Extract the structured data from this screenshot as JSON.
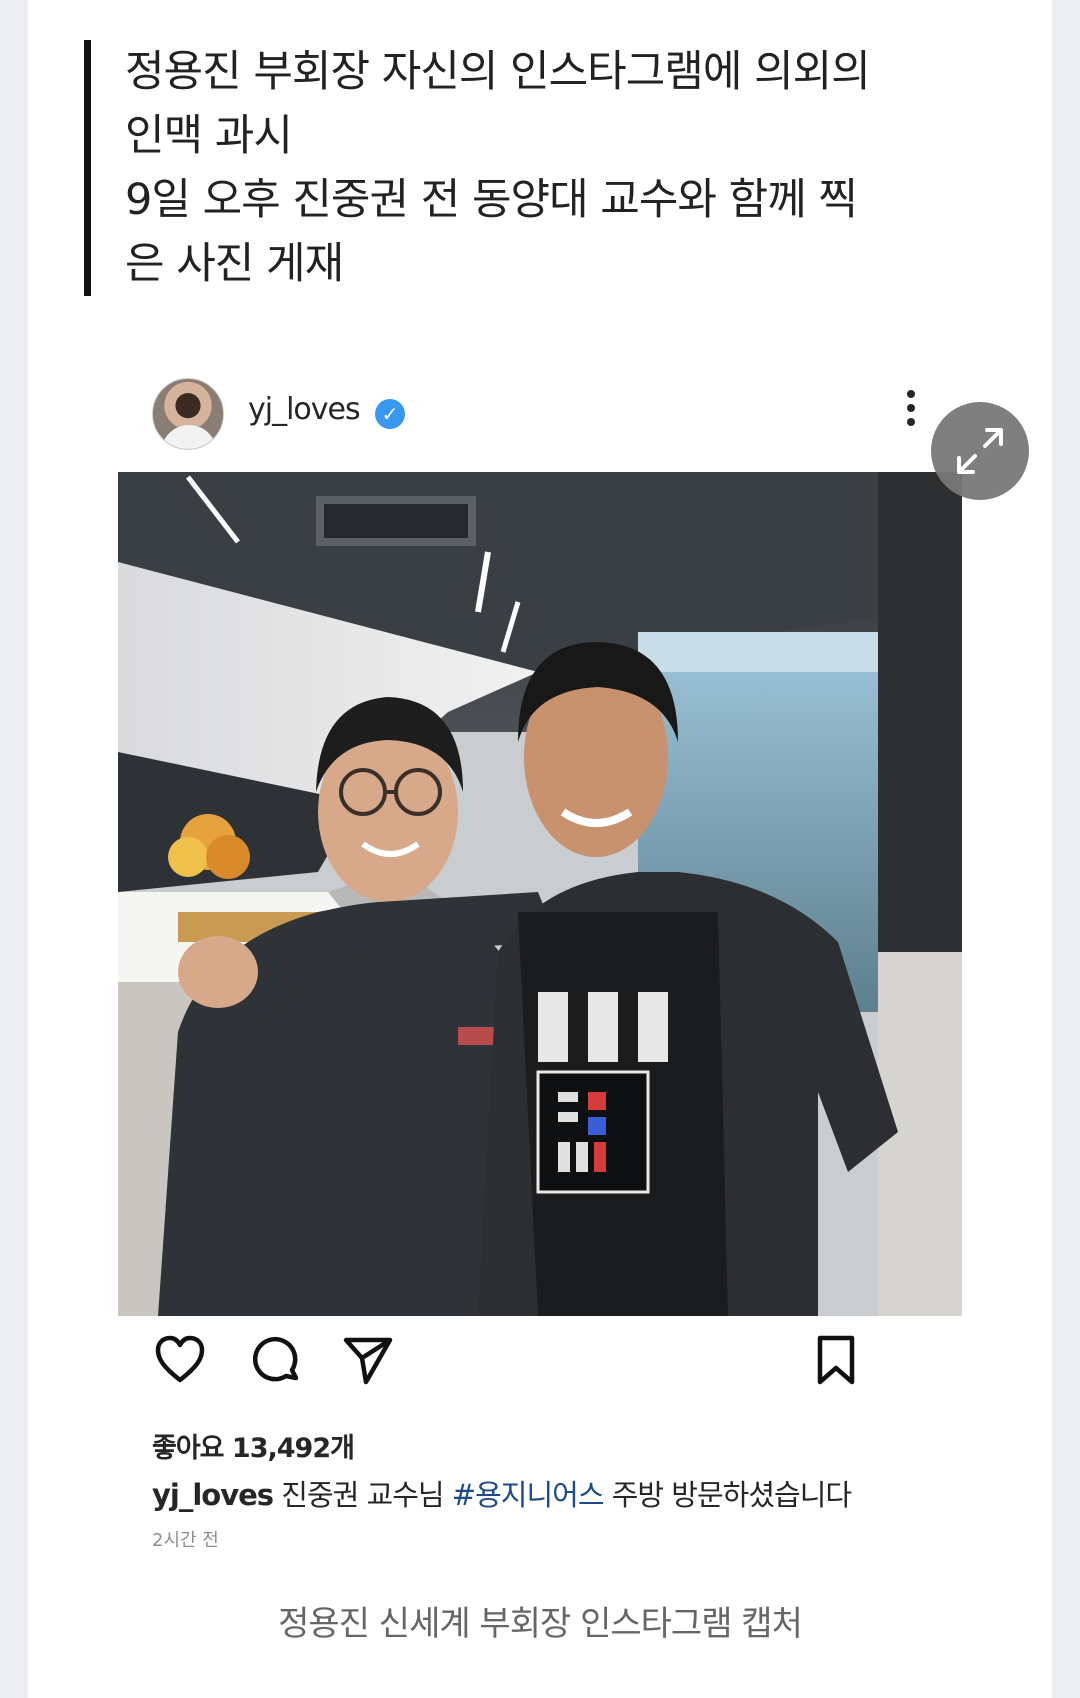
{
  "summary": {
    "lines": [
      "정용진 부회장 자신의 인스타그램에 의외의",
      "인맥 과시",
      "9일 오후 진중권 전 동양대 교수와 함께 찍",
      "은 사진 게재"
    ]
  },
  "instagram_post": {
    "username": "yj_loves",
    "verified_badge": "✓",
    "likes": "좋아요 13,492개",
    "caption_user": "yj_loves",
    "caption_text_before": " 진중권 교수님 ",
    "caption_hashtag": "#용지니어스",
    "caption_text_after": " 주방 방문하셨습니다",
    "time": "2시간 전",
    "icons": [
      "heart-icon",
      "comment-icon",
      "send-icon",
      "bookmark-icon",
      "more-options-icon"
    ]
  },
  "photo": {
    "description_icon": "photo-two-men-in-kitchen"
  },
  "expand_button_icon": "expand-arrows-icon",
  "figure_caption": "정용진 신세계 부회장 인스타그램 캡처",
  "colors": {
    "hashtag": "#1c4a8a",
    "verified": "#3897f0",
    "summary_bar": "#111111"
  }
}
